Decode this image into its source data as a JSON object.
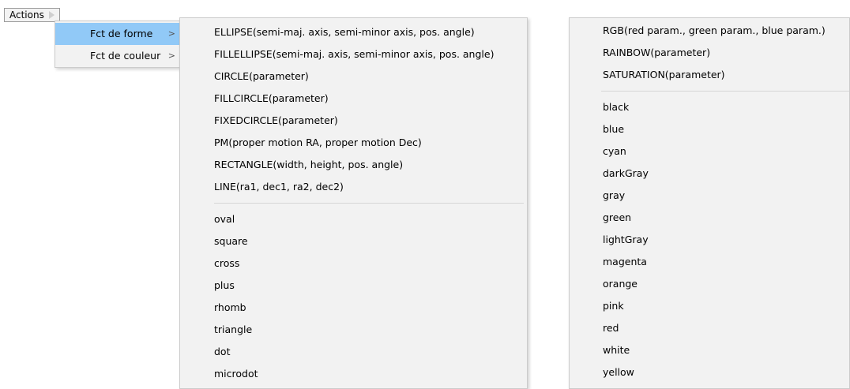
{
  "actions_button": {
    "label": "Actions"
  },
  "main_menu": {
    "items": [
      {
        "label": "Fct de forme",
        "highlighted": true
      },
      {
        "label": "Fct de couleur",
        "highlighted": false
      }
    ],
    "submenu_arrow": ">"
  },
  "forme_menu": {
    "functions": [
      "ELLIPSE(semi-maj. axis, semi-minor axis, pos. angle)",
      "FILLELLIPSE(semi-maj. axis, semi-minor axis, pos. angle)",
      "CIRCLE(parameter)",
      "FILLCIRCLE(parameter)",
      "FIXEDCIRCLE(parameter)",
      "PM(proper motion RA, proper motion Dec)",
      "RECTANGLE(width, height, pos. angle)",
      "LINE(ra1, dec1, ra2, dec2)"
    ],
    "shapes": [
      "oval",
      "square",
      "cross",
      "plus",
      "rhomb",
      "triangle",
      "dot",
      "microdot"
    ]
  },
  "couleur_menu": {
    "functions": [
      "RGB(red param., green param., blue param.)",
      "RAINBOW(parameter)",
      "SATURATION(parameter)"
    ],
    "colors": [
      "black",
      "blue",
      "cyan",
      "darkGray",
      "gray",
      "green",
      "lightGray",
      "magenta",
      "orange",
      "pink",
      "red",
      "white",
      "yellow"
    ]
  },
  "highlight_color": "#91c9f7"
}
